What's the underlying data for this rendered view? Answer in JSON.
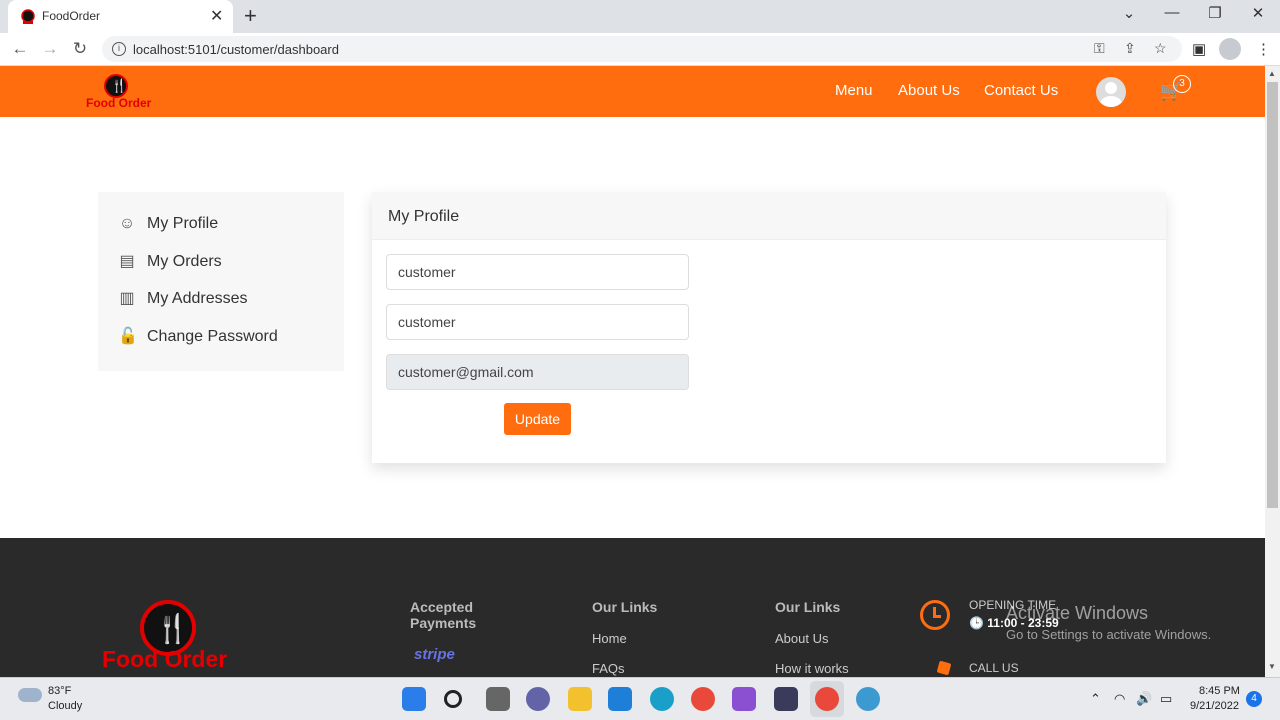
{
  "browser": {
    "tab_title": "FoodOrder",
    "tab_close": "✕",
    "new_tab": "+",
    "url": "localhost:5101/customer/dashboard",
    "window_controls": [
      "⌄",
      "—",
      "❐",
      "✕"
    ]
  },
  "site": {
    "logo_text": "Food Order",
    "logo_glyph": "🍴",
    "nav": [
      "Menu",
      "About Us",
      "Contact Us"
    ],
    "cart_count": "3",
    "accent_color": "#ff6d0e"
  },
  "sidebar": {
    "items": [
      {
        "label": "My Profile",
        "icon": "user-circle-icon",
        "glyph": "☺"
      },
      {
        "label": "My Orders",
        "icon": "box-icon",
        "glyph": "▤"
      },
      {
        "label": "My Addresses",
        "icon": "book-icon",
        "glyph": "▥"
      },
      {
        "label": "Change Password",
        "icon": "lock-icon",
        "glyph": "🔓"
      }
    ]
  },
  "profile": {
    "title": "My Profile",
    "first_name": "customer",
    "last_name": "customer",
    "email": "customer@gmail.com",
    "update_label": "Update"
  },
  "footer": {
    "payments_heading": "Accepted Payments",
    "stripe_label": "stripe",
    "links_heading_1": "Our Links",
    "links_1": [
      "Home",
      "FAQs"
    ],
    "links_heading_2": "Our Links",
    "links_2": [
      "About Us",
      "How it works"
    ],
    "opening_label": "OPENING TIME",
    "opening_hours": "🕒 11:00 - 23:59",
    "call_label": "CALL US"
  },
  "watermark": {
    "title": "Activate Windows",
    "subtitle": "Go to Settings to activate Windows."
  },
  "taskbar": {
    "temperature": "83°F",
    "condition": "Cloudy",
    "time": "8:45 PM",
    "date": "9/21/2022",
    "notifications": "4"
  }
}
